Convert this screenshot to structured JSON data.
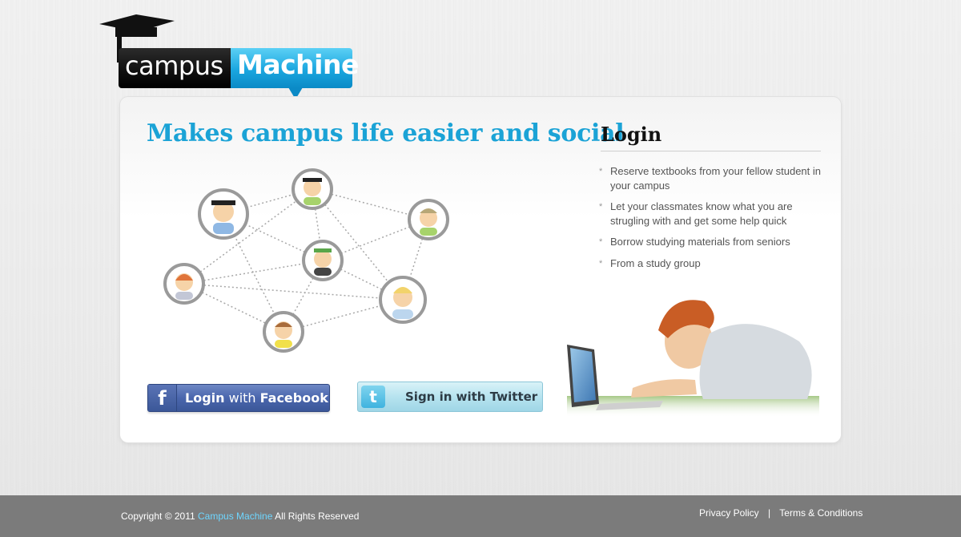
{
  "logo": {
    "word1": "campus",
    "word2": "Machine"
  },
  "hero": {
    "tagline": "Makes campus life easier and social"
  },
  "login": {
    "title": "Login",
    "features": [
      "Reserve textbooks from your fellow student in your campus",
      "Let your classmates know what you are strugling with and get some help quick",
      "Borrow studying materials from seniors",
      "From a study group"
    ],
    "bullet": "*"
  },
  "buttons": {
    "facebook": {
      "icon": "f",
      "label_bold": "Login",
      "label_light": "with",
      "label_brand": "Facebook"
    },
    "twitter": {
      "icon": "t",
      "label": "Sign in with Twitter"
    }
  },
  "footer": {
    "copyright_prefix": "Copyright © 2011",
    "brand": "Campus Machine",
    "copyright_suffix": "All Rights Reserved",
    "links": {
      "privacy": "Privacy Policy",
      "separator": "|",
      "terms": "Terms & Conditions"
    }
  },
  "colors": {
    "brand_blue": "#1ba3d6",
    "facebook": "#3b5798",
    "twitter": "#b6e3ef",
    "footer": "#7b7b7b"
  }
}
